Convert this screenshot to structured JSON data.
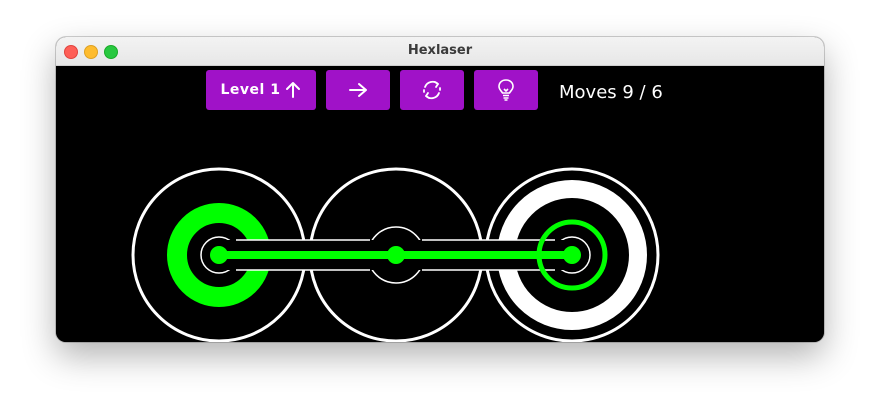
{
  "window": {
    "title": "Hexlaser"
  },
  "toolbar": {
    "level_label": "Level 1",
    "level_icon": "arrow-up-icon",
    "next_icon": "arrow-right-icon",
    "reset_icon": "refresh-cycle-icon",
    "hint_icon": "lightbulb-icon",
    "button_color": "#a012c8"
  },
  "status": {
    "moves_text": "Moves 9 / 6"
  },
  "board": {
    "cells": [
      {
        "kind": "laser-source",
        "state": "lit"
      },
      {
        "kind": "relay",
        "state": "lit"
      },
      {
        "kind": "target",
        "state": "lit"
      }
    ],
    "beam_color": "#00ff00",
    "ring_color": "#ffffff"
  }
}
